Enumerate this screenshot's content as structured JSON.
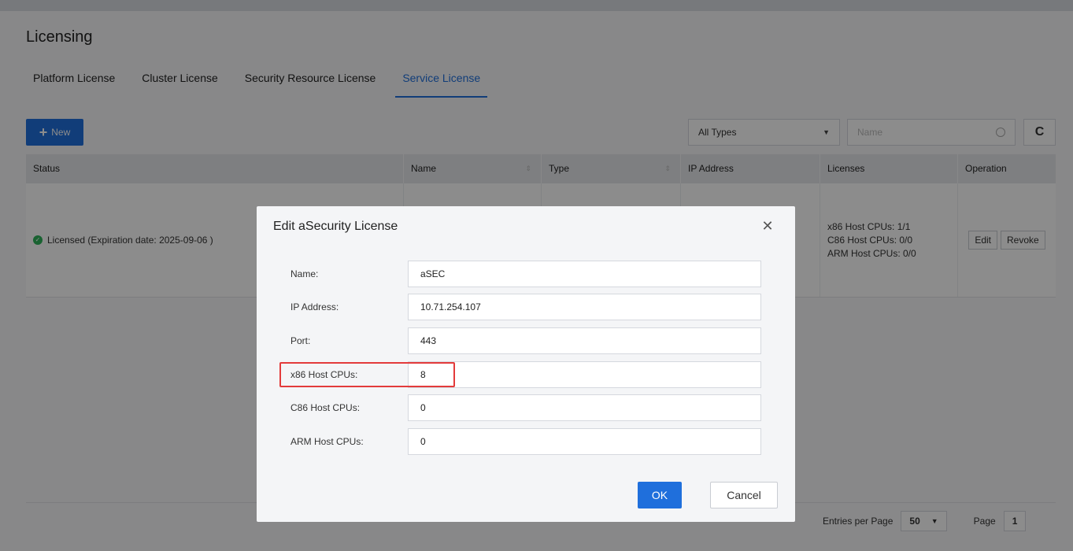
{
  "page": {
    "title": "Licensing"
  },
  "tabs": [
    {
      "label": "Platform License"
    },
    {
      "label": "Cluster License"
    },
    {
      "label": "Security Resource License"
    },
    {
      "label": "Service License"
    }
  ],
  "toolbar": {
    "new_label": "New",
    "type_select_value": "All Types",
    "name_placeholder": "Name"
  },
  "table": {
    "columns": [
      "Status",
      "Name",
      "Type",
      "IP Address",
      "Licenses",
      "Operation"
    ],
    "rows": [
      {
        "status": "Licensed (Expiration date: 2025-09-06 )",
        "licenses": [
          "x86 Host CPUs: 1/1",
          "C86 Host CPUs: 0/0",
          "ARM Host CPUs: 0/0"
        ],
        "edit_label": "Edit",
        "revoke_label": "Revoke"
      }
    ]
  },
  "pager": {
    "entries_label": "Entries per Page",
    "entries_value": "50",
    "page_label": "Page",
    "page_value": "1"
  },
  "modal": {
    "title": "Edit aSecurity License",
    "fields": [
      {
        "label": "Name:",
        "value": "aSEC"
      },
      {
        "label": "IP Address:",
        "value": "10.71.254.107"
      },
      {
        "label": "Port:",
        "value": "443"
      },
      {
        "label": "x86 Host CPUs:",
        "value": "8"
      },
      {
        "label": "C86 Host CPUs:",
        "value": "0"
      },
      {
        "label": "ARM Host CPUs:",
        "value": "0"
      }
    ],
    "ok_label": "OK",
    "cancel_label": "Cancel"
  },
  "colors": {
    "accent": "#1f6fdc",
    "success": "#2fb25a",
    "highlight": "#e33b3b"
  }
}
